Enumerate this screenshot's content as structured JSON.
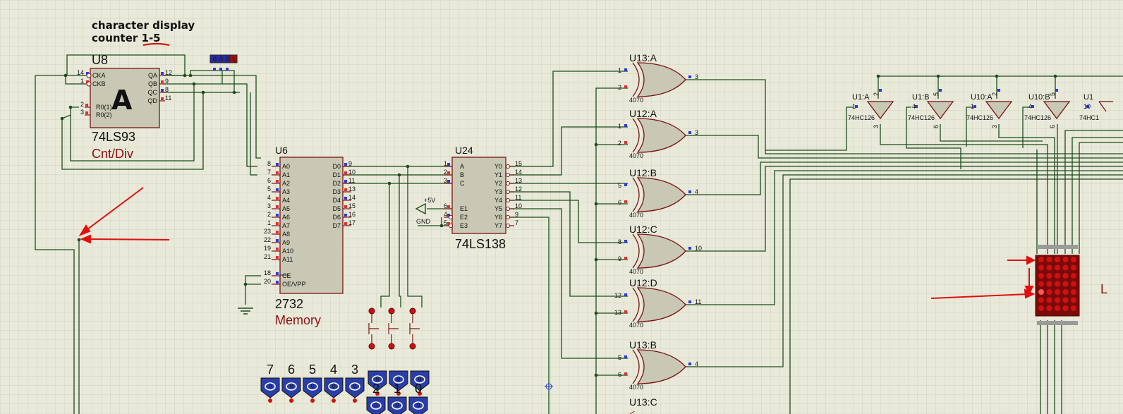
{
  "annotation": {
    "line1": "character display",
    "line2": "counter 1-5"
  },
  "u8": {
    "ref": "U8",
    "type": "74LS93",
    "desc": "Cnt/Div",
    "glyph": "A",
    "pins_left": [
      {
        "num": "14",
        "name": "CKA"
      },
      {
        "num": "1",
        "name": "CKB"
      },
      {
        "num": "2",
        "name": "R0(1)"
      },
      {
        "num": "3",
        "name": "R0(2)"
      }
    ],
    "pins_right": [
      {
        "num": "12",
        "name": "QA"
      },
      {
        "num": "9",
        "name": "QB"
      },
      {
        "num": "8",
        "name": "QC"
      },
      {
        "num": "11",
        "name": "QD"
      }
    ]
  },
  "u6": {
    "ref": "U6",
    "type": "2732",
    "desc": "Memory",
    "addr_pins": [
      {
        "num": "8",
        "name": "A0"
      },
      {
        "num": "7",
        "name": "A1"
      },
      {
        "num": "6",
        "name": "A2"
      },
      {
        "num": "5",
        "name": "A3"
      },
      {
        "num": "4",
        "name": "A4"
      },
      {
        "num": "3",
        "name": "A5"
      },
      {
        "num": "2",
        "name": "A6"
      },
      {
        "num": "1",
        "name": "A7"
      },
      {
        "num": "23",
        "name": "A8"
      },
      {
        "num": "22",
        "name": "A9"
      },
      {
        "num": "19",
        "name": "A10"
      },
      {
        "num": "21",
        "name": "A11"
      }
    ],
    "ctrl_pins": [
      {
        "num": "18",
        "name": "CE"
      },
      {
        "num": "20",
        "name": "OE/VPP"
      }
    ],
    "data_pins": [
      {
        "num": "9",
        "name": "D0"
      },
      {
        "num": "10",
        "name": "D1"
      },
      {
        "num": "11",
        "name": "D2"
      },
      {
        "num": "13",
        "name": "D3"
      },
      {
        "num": "14",
        "name": "D4"
      },
      {
        "num": "15",
        "name": "D5"
      },
      {
        "num": "16",
        "name": "D6"
      },
      {
        "num": "17",
        "name": "D7"
      }
    ]
  },
  "u24": {
    "ref": "U24",
    "type": "74LS138",
    "pins_left": [
      {
        "num": "1",
        "name": "A"
      },
      {
        "num": "2",
        "name": "B"
      },
      {
        "num": "3",
        "name": "C"
      },
      {
        "num": "6",
        "name": "E1"
      },
      {
        "num": "4",
        "name": "E2"
      },
      {
        "num": "5",
        "name": "E3"
      }
    ],
    "pins_right": [
      {
        "num": "15",
        "name": "Y0"
      },
      {
        "num": "14",
        "name": "Y1"
      },
      {
        "num": "13",
        "name": "Y2"
      },
      {
        "num": "12",
        "name": "Y3"
      },
      {
        "num": "11",
        "name": "Y4"
      },
      {
        "num": "10",
        "name": "Y5"
      },
      {
        "num": "9",
        "name": "Y6"
      },
      {
        "num": "7",
        "name": "Y7"
      }
    ]
  },
  "power": {
    "vcc": "+5V",
    "gnd": "GND"
  },
  "xor_gates": [
    {
      "ref": "U13:A",
      "in1": "1",
      "in2": "2",
      "out": "3",
      "part": "4070"
    },
    {
      "ref": "U12:A",
      "in1": "1",
      "in2": "2",
      "out": "3",
      "part": "4070"
    },
    {
      "ref": "U12:B",
      "in1": "5",
      "in2": "6",
      "out": "4",
      "part": "4070"
    },
    {
      "ref": "U12:C",
      "in1": "8",
      "in2": "9",
      "out": "10",
      "part": "4070"
    },
    {
      "ref": "U12:D",
      "in1": "12",
      "in2": "13",
      "out": "11",
      "part": "4070"
    },
    {
      "ref": "U13:B",
      "in1": "5",
      "in2": "6",
      "out": "4",
      "part": "4070"
    }
  ],
  "xor_partial": {
    "ref": "U13:C"
  },
  "buffers": [
    {
      "ref": "U1:A",
      "in": "1",
      "oe": "2",
      "out": "3",
      "part": "74HC126"
    },
    {
      "ref": "U1:B",
      "in": "4",
      "oe": "5",
      "out": "6",
      "part": "74HC126"
    },
    {
      "ref": "U10:A",
      "in": "1",
      "oe": "2",
      "out": "3",
      "part": "74HC126"
    },
    {
      "ref": "U10:B",
      "in": "4",
      "oe": "5",
      "out": "6",
      "part": "74HC126"
    },
    {
      "ref": "U1",
      "in": "10",
      "oe": "",
      "out": "",
      "part": "74HC1"
    }
  ],
  "connector": {
    "labels": [
      "0",
      "0",
      "0",
      "1"
    ]
  },
  "logic_probes_top": [
    "0",
    "0",
    "0"
  ],
  "logic_probes_bottom": [
    {
      "label": "7",
      "value": "0"
    },
    {
      "label": "6",
      "value": "0"
    },
    {
      "label": "5",
      "value": "0"
    },
    {
      "label": "4",
      "value": "0"
    },
    {
      "label": "3",
      "value": "0"
    },
    {
      "label": "2",
      "value": "0"
    },
    {
      "label": "1",
      "value": "0"
    },
    {
      "label": "0",
      "value": "0"
    }
  ],
  "matrix": {
    "label": "L"
  },
  "colors": {
    "background": "#e9e9da",
    "grid": "#d3d3c3",
    "wire": "#1b4d1b",
    "body": "#c8c8b4",
    "outline": "#7a1414",
    "annotation": "#e01010",
    "led": "#c00000"
  }
}
